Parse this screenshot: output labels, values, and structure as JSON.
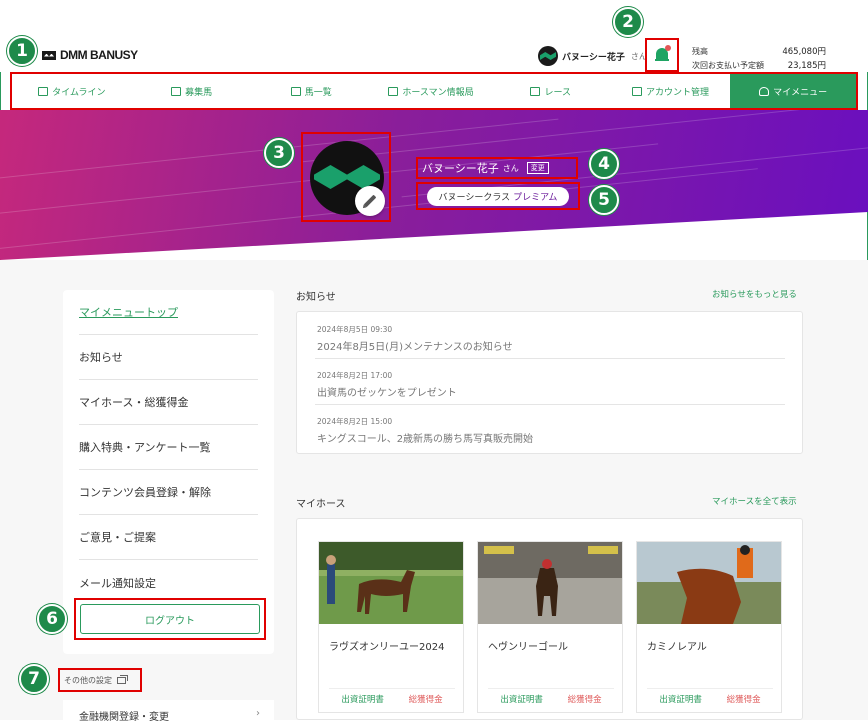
{
  "header": {
    "logo_text": "DMM BANUSY",
    "user_name": "バヌーシー花子",
    "user_suffix": "さん",
    "balance_label": "残高",
    "balance_value": "465,080円",
    "scheduled_label": "次回お支払い予定額",
    "scheduled_value": "23,185円"
  },
  "nav": {
    "items": [
      {
        "label": "タイムライン",
        "icon": "timeline-icon"
      },
      {
        "label": "募集馬",
        "icon": "wallet-icon"
      },
      {
        "label": "馬一覧",
        "icon": "horse-icon"
      },
      {
        "label": "ホースマン情報局",
        "icon": "info-icon"
      },
      {
        "label": "レース",
        "icon": "flag-icon"
      },
      {
        "label": "アカウント管理",
        "icon": "card-icon"
      },
      {
        "label": "マイメニュー",
        "icon": "person-icon"
      }
    ]
  },
  "profile": {
    "name": "バヌーシー花子",
    "suffix": "さん",
    "change_label": "変更",
    "class_prefix": "バヌーシークラス",
    "class_value": "プレミアム"
  },
  "badges": [
    "1",
    "2",
    "3",
    "4",
    "5",
    "6",
    "7"
  ],
  "sidebar": {
    "items": [
      {
        "label": "マイメニュートップ"
      },
      {
        "label": "お知らせ"
      },
      {
        "label": "マイホース・総獲得金"
      },
      {
        "label": "購入特典・アンケート一覧"
      },
      {
        "label": "コンテンツ会員登録・解除"
      },
      {
        "label": "ご意見・ご提案"
      },
      {
        "label": "メール通知設定"
      }
    ],
    "logout_label": "ログアウト",
    "other_settings_label": "その他の設定",
    "bank_label": "金融機関登録・変更"
  },
  "news": {
    "title": "お知らせ",
    "more_link": "お知らせをもっと見る",
    "items": [
      {
        "date": "2024年8月5日 09:30",
        "title": "2024年8月5日(月)メンテナンスのお知らせ"
      },
      {
        "date": "2024年8月2日 17:00",
        "title": "出資馬のゼッケンをプレゼント"
      },
      {
        "date": "2024年8月2日 15:00",
        "title": "キングスコール、2歳新馬の勝ち馬写真販売開始"
      }
    ]
  },
  "myhorse": {
    "title": "マイホース",
    "more_link": "マイホースを全て表示",
    "horses": [
      {
        "name": "ラヴズオンリーユー2024",
        "cert": "出資証明書",
        "earnings": "総獲得金"
      },
      {
        "name": "ヘヴンリーゴール",
        "cert": "出資証明書",
        "earnings": "総獲得金"
      },
      {
        "name": "カミノレアル",
        "cert": "出資証明書",
        "earnings": "総獲得金"
      }
    ]
  },
  "colors": {
    "brand_green": "#2a9a5c",
    "highlight_red": "#e00000",
    "hero_start": "#c5287c",
    "hero_end": "#6a0fbf"
  }
}
